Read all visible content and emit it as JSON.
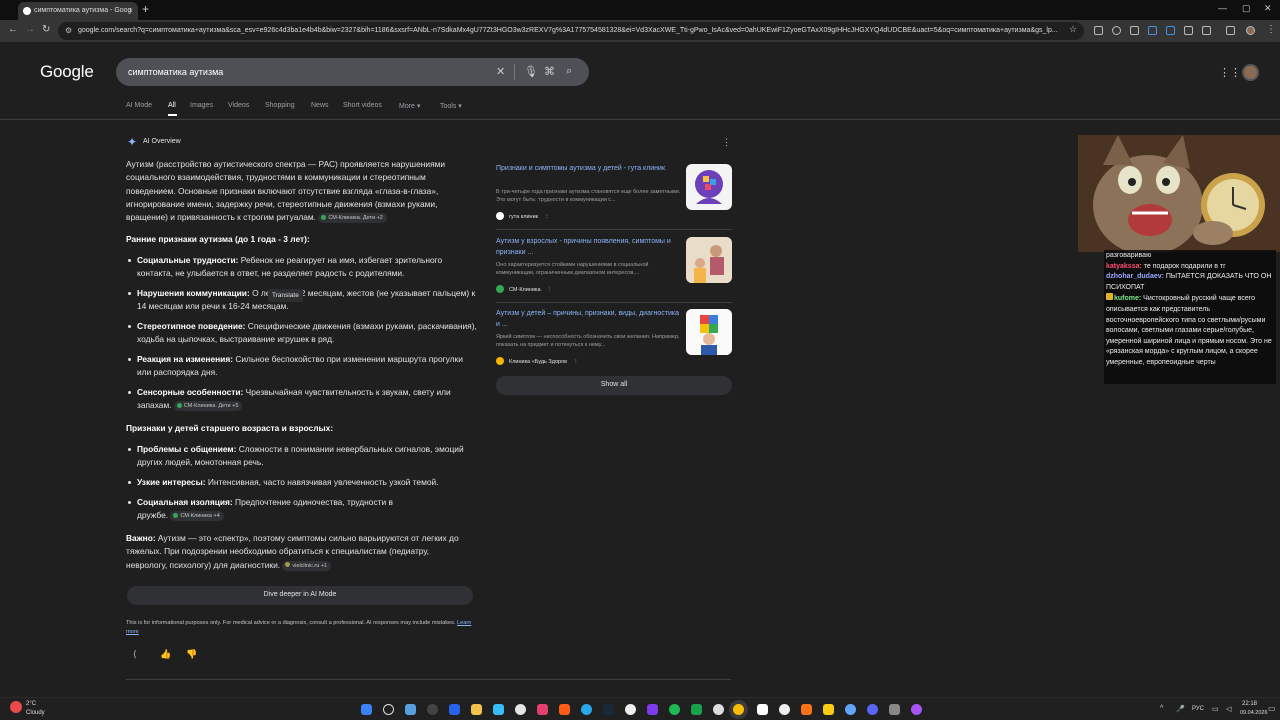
{
  "browser": {
    "tab_title": "симптоматика аутизма - Goog",
    "tab_close": "×",
    "new_tab": "+",
    "url": "google.com/search?q=симптоматика+аутизма&sca_esv=e926c4d3ba1e4b4b&biw=2327&bih=1186&sxsrf=ANbL-n7SdkaMx4gU77Zt3HGO3w3zREXV7g%3A1775754581328&ei=Vd3XacXWE_Tti-gPwo_IsAc&ved=0ahUKEwiF1ZyoeGTAxX09gIHHcJHGXYQ4dUDCBE&uact=5&oq=симптоматика+аутизма&gs_lp..."
  },
  "google": {
    "logo": "Google",
    "query": "симптоматика аутизма",
    "tabs": [
      "AI Mode",
      "All",
      "Images",
      "Videos",
      "Shopping",
      "News",
      "Short videos",
      "More ▾",
      "Tools ▾"
    ],
    "active_tab": "All"
  },
  "ai_overview": {
    "title": "AI Overview",
    "intro": "Аутизм (расстройство аутистического спектра — РАС) проявляется нарушениями социального взаимодействия, трудностями в коммуникации и стереотипным поведением. Основные признаки включают отсутствие взгляда «глаза-в-глаза», игнорирование имени, задержку речи, стереотипные движения (взмахи руками, вращение) и привязанность к строгим ритуалам.",
    "intro_chip": "СМ-Клиника. Дети +2",
    "early_heading": "Ранние признаки аутизма (до 1 года - 3 лет):",
    "early": [
      {
        "b": "Социальные трудности:",
        "t": " Ребенок не реагирует на имя, избегает зрительного контакта, не улыбается в ответ, не разделяет радость с родителями."
      },
      {
        "b": "Нарушения коммуникации:",
        "t": " О лепета к 12 месяцам, жестов (не указывает пальцем) к 14 месяцам или речи к 16-24 месяцам."
      },
      {
        "b": "Стереотипное поведение:",
        "t": " Специфические движения (взмахи руками, раскачивания), ходьба на цыпочках, выстраивание игрушек в ряд."
      },
      {
        "b": "Реакция на изменения:",
        "t": " Сильное беспокойство при изменении маршрута прогулки или распорядка дня."
      },
      {
        "b": "Сенсорные особенности:",
        "t": " Чрезвычайная чувствительность к звукам, свету или запахам."
      }
    ],
    "early_chip": "СМ-Клиника. Дети +5",
    "older_heading": "Признаки у детей старшего возраста и взрослых:",
    "older": [
      {
        "b": "Проблемы с общением:",
        "t": " Сложности в понимании невербальных сигналов, эмоций других людей, монотонная речь."
      },
      {
        "b": "Узкие интересы:",
        "t": " Интенсивная, часто навязчивая увлеченность узкой темой."
      },
      {
        "b": "Социальная изоляция:",
        "t": " Предпочтение одиночества, трудности в дружбе."
      }
    ],
    "older_chip": "СМ-Клиника +4",
    "important_b": "Важно:",
    "important_t": " Аутизм — это «спектр», поэтому симптомы сильно варьируются от легких до тяжелых. При подозрении необходимо обратиться к специалистам (педиатру, неврологу, психологу) для диагностики.",
    "important_chip": "vielclinic.ru +1",
    "tooltip": "Translate",
    "dive_button": "Dive deeper in AI Mode",
    "disclaimer": "This is for informational purposes only. For medical advice or a diagnosis, consult a professional. AI responses may include mistakes.",
    "learn_more": "Learn more"
  },
  "sources": [
    {
      "title": "Признаки и симптомы аутизма у детей - гута клиник",
      "snippet": "В три-четыре года признаки аутизма становятся еще более заметными. Это могут быть: трудности в коммуникации с...",
      "site": "гута клиник"
    },
    {
      "title": "Аутизм у взрослых - причины появления, симптомы и признаки ...",
      "snippet": "Оно характеризуется стойкими нарушениями в социальной коммуникации, ограниченным диапазоном интересов,...",
      "site": "СМ-Клиника"
    },
    {
      "title": "Аутизм у детей – причины, признаки, виды, диагностика и ...",
      "snippet": "Яркий симптом — неспособность обозначить свои желания. Например, показать на предмет и потянуться к нему...",
      "site": "Клиника «Будь Здоров"
    }
  ],
  "show_all": "Show all",
  "chat": [
    {
      "name": "",
      "text": "разговариваю",
      "color": "#ffffff"
    },
    {
      "name": "katyakssa:",
      "text": " те подарок подарили в тг",
      "color": "#ff4d6d"
    },
    {
      "name": "dzhohar_dudaev:",
      "text": " ПЫТАЕТСЯ ДОКАЗАТЬ ЧТО ОН ПСИХОПАТ",
      "color": "#9aa7ff"
    },
    {
      "name": "kufome:",
      "text": " Чистокровный русский чаще всего описывается как представитель восточноевропейского типа со светлыми/русыми волосами, светлыми глазами серые/голубые, умеренной шириной лица и прямым носом. Это не «рязанская морда» с круглым лицом, а скорее умеренные, европеоидные черты",
      "color": "#7ee787"
    }
  ],
  "weather": {
    "temp": "2°C",
    "cond": "Cloudy"
  },
  "clock": {
    "time": "22:18",
    "date": "09.04.2026"
  },
  "lang": "РУС"
}
